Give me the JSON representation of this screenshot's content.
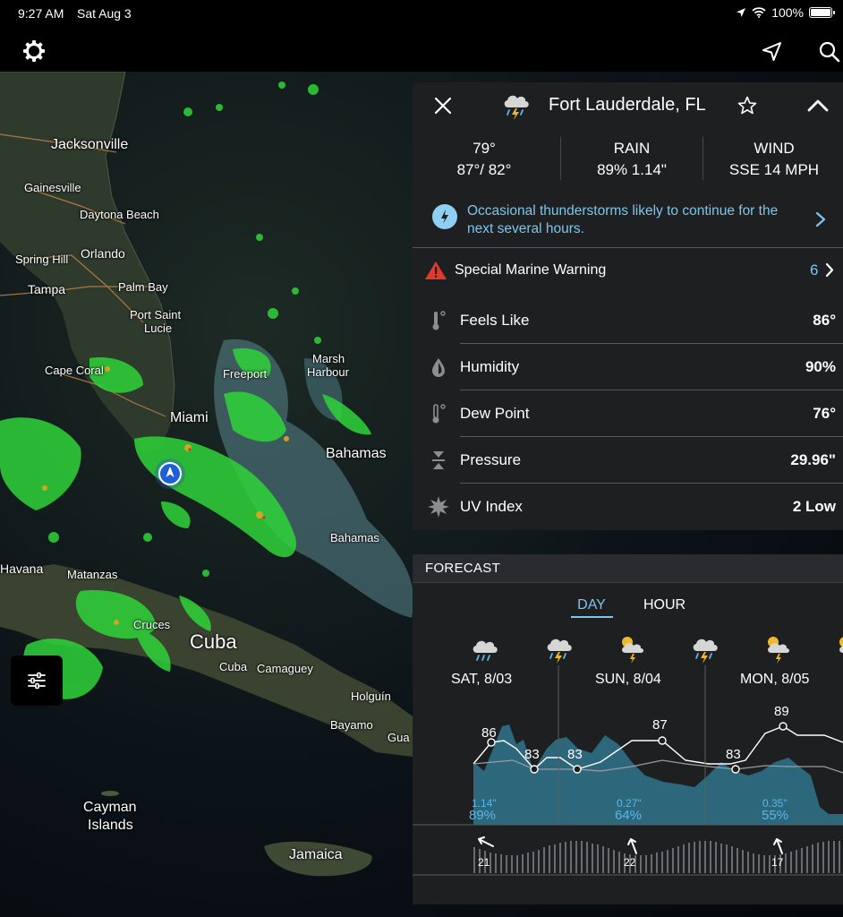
{
  "status_bar": {
    "time": "9:27 AM",
    "date": "Sat Aug 3",
    "battery": "100%"
  },
  "toolbar": {
    "settings_icon": "gear-icon",
    "locate_icon": "location-arrow-icon",
    "search_icon": "search-icon"
  },
  "map": {
    "labels": {
      "jacksonville": "Jacksonville",
      "gainesville": "Gainesville",
      "daytona": "Daytona Beach",
      "orlando": "Orlando",
      "spring_hill": "Spring Hill",
      "tampa": "Tampa",
      "palm_bay": "Palm Bay",
      "port_saint_lucie_1": "Port Saint",
      "port_saint_lucie_2": "Lucie",
      "cape_coral": "Cape Coral",
      "freeport": "Freeport",
      "marsh_harbour_1": "Marsh",
      "marsh_harbour_2": "Harbour",
      "miami": "Miami",
      "bahamas_big": "Bahamas",
      "bahamas_small": "Bahamas",
      "havana": "Havana",
      "matanzas": "Matanzas",
      "cruces": "Cruces",
      "cuba_big": "Cuba",
      "cuba_small": "Cuba",
      "camaguey": "Camaguey",
      "holguin": "Holguín",
      "bayamo": "Bayamo",
      "gua": "Gua",
      "cayman_1": "Cayman",
      "cayman_2": "Islands",
      "jamaica": "Jamaica"
    }
  },
  "panel": {
    "location": "Fort Lauderdale, FL",
    "summary": {
      "temp": "79°",
      "hi_lo": "87°/ 82°",
      "rain_label": "RAIN",
      "rain_value": "89% 1.14\"",
      "wind_label": "WIND",
      "wind_value": "SSE 14 MPH"
    },
    "alert_text": "Occasional thunderstorms likely to continue for the next several hours.",
    "warning": {
      "label": "Special Marine Warning",
      "count": "6"
    },
    "details": [
      {
        "label": "Feels Like",
        "value": "86°",
        "icon": "thermometer-icon"
      },
      {
        "label": "Humidity",
        "value": "90%",
        "icon": "droplet-icon"
      },
      {
        "label": "Dew Point",
        "value": "76°",
        "icon": "thermometer-icon"
      },
      {
        "label": "Pressure",
        "value": "29.96\"",
        "icon": "pressure-icon"
      },
      {
        "label": "UV Index",
        "value": "2 Low",
        "icon": "sun-icon"
      }
    ]
  },
  "forecast": {
    "title": "FORECAST",
    "tabs": {
      "day": "DAY",
      "hour": "HOUR"
    },
    "days": [
      {
        "label": "SAT, 8/03",
        "high": "86",
        "low": "83",
        "rain_amount": "1.14\"",
        "rain_chance": "89%",
        "wind": "21"
      },
      {
        "label": "SUN, 8/04",
        "high": "87",
        "low": "83",
        "rain_amount": "0.27\"",
        "rain_chance": "64%",
        "wind": "22"
      },
      {
        "label": "MON, 8/05",
        "high": "89",
        "low": "83",
        "rain_amount": "0.35\"",
        "rain_chance": "55%",
        "wind": "17"
      }
    ],
    "colors": {
      "accent": "#7cc6ee",
      "precip": "#2e6f86"
    }
  }
}
